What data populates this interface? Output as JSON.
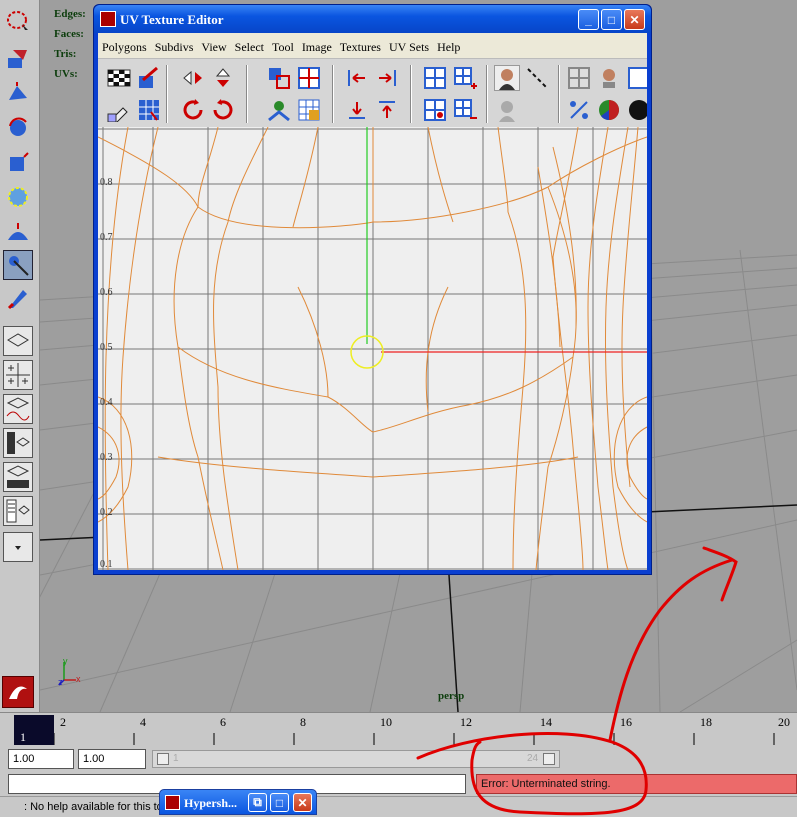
{
  "viewport": {
    "hud": {
      "edges": "Edges:",
      "faces": "Faces:",
      "tris": "Tris:",
      "uvs": "UVs:"
    },
    "camera_label": "persp",
    "axis_labels": {
      "x": "x",
      "y": "y",
      "z": "z"
    }
  },
  "uv_editor": {
    "title": "UV Texture Editor",
    "menu": [
      "Polygons",
      "Subdivs",
      "View",
      "Select",
      "Tool",
      "Image",
      "Textures",
      "UV Sets",
      "Help"
    ],
    "v_labels": [
      "0.8",
      "0.7",
      "0.6",
      "0.5",
      "0.4",
      "0.3",
      "0.2",
      "0.1"
    ],
    "window_buttons": {
      "minimize": "_",
      "maximize": "□",
      "close": "✕"
    }
  },
  "timeline": {
    "current_frame": "1",
    "ticks": [
      "2",
      "4",
      "6",
      "8",
      "10",
      "12",
      "14",
      "16",
      "18",
      "20"
    ]
  },
  "range": {
    "start": "1.00",
    "playback_start": "1.00",
    "slider_start": "1",
    "slider_end": "24"
  },
  "command_line": {
    "error": "Error: Unterminated string."
  },
  "help_line": {
    "text": ": No help available for this to"
  },
  "taskbar": {
    "hypershade_label": "Hypersh..."
  },
  "colors": {
    "uv_lines": "#e08a3a",
    "error_bg": "#ec6a6a",
    "annotation": "#e00000",
    "title_blue": "#0a55e0"
  }
}
